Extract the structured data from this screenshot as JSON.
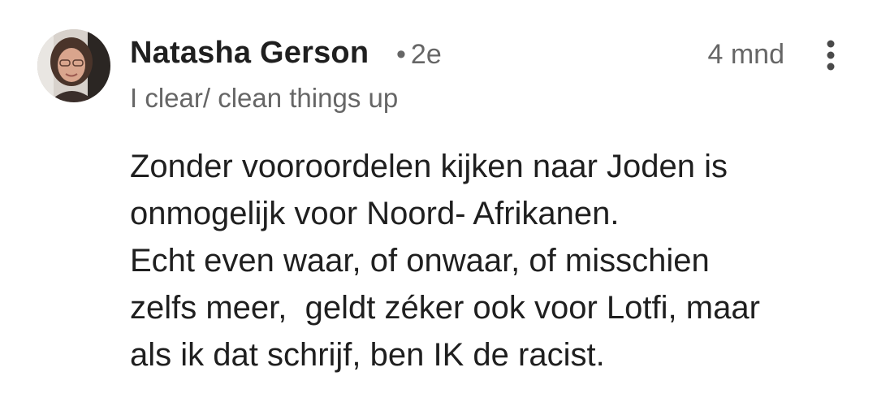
{
  "comment": {
    "author_name": "Natasha Gerson",
    "connection_degree": "2e",
    "separator": "•",
    "time_ago": "4 mnd",
    "headline": "I clear/ clean things up",
    "avatar_icon": "profile-photo",
    "more_icon": "more-vertical-icon",
    "body_lines": [
      "Zonder vooroordelen kijken naar Joden is",
      "onmogelijk voor Noord- Afrikanen.",
      "Echt even waar, of onwaar, of misschien",
      "zelfs meer,  geldt zéker ook voor Lotfi, maar",
      "als ik dat schrijf, ben IK de racist."
    ]
  },
  "colors": {
    "primary_text": "#1f1f1f",
    "secondary_text": "#666666",
    "background": "#ffffff"
  }
}
